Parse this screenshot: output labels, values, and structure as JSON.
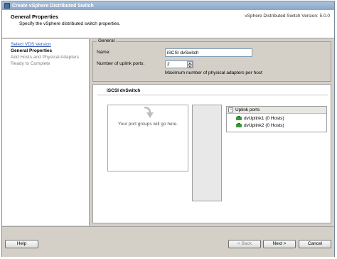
{
  "window": {
    "title": "Create vSphere Distributed Switch",
    "icon": "vsphere-wizard-icon"
  },
  "header": {
    "title": "General Properties",
    "subtitle": "Specify the vSphere distributed switch properties.",
    "version": "vSphere Distributed Switch Version: 5.0.0"
  },
  "steps": [
    {
      "label": "Select VDS Version",
      "state": "done"
    },
    {
      "label": "General Properties",
      "state": "current"
    },
    {
      "label": "Add Hosts and Physical Adapters",
      "state": "future"
    },
    {
      "label": "Ready to Complete",
      "state": "future"
    }
  ],
  "general": {
    "legend": "General",
    "name_label": "Name:",
    "name_value": "iSCSI dvSwitch",
    "uplinks_label": "Number of uplink ports:",
    "uplinks_value": "2",
    "max_note": "Maximum number of physical adapters per host"
  },
  "preview": {
    "switch_name": "iSCSI dvSwitch",
    "port_groups_placeholder": "Your port groups will go here.",
    "uplink_ports_title": "Uplink ports",
    "uplinks": [
      {
        "label": "dvUplink1 (0 Hosts)",
        "icon": "uplink-icon"
      },
      {
        "label": "dvUplink2 (0 Hosts)",
        "icon": "uplink-icon"
      }
    ]
  },
  "buttons": {
    "help": "Help",
    "back": "< Back",
    "next": "Next >",
    "cancel": "Cancel"
  },
  "colors": {
    "title_bar": "#8aa6c8",
    "link": "#3355aa",
    "uplink_green": "#3a9a3a"
  }
}
